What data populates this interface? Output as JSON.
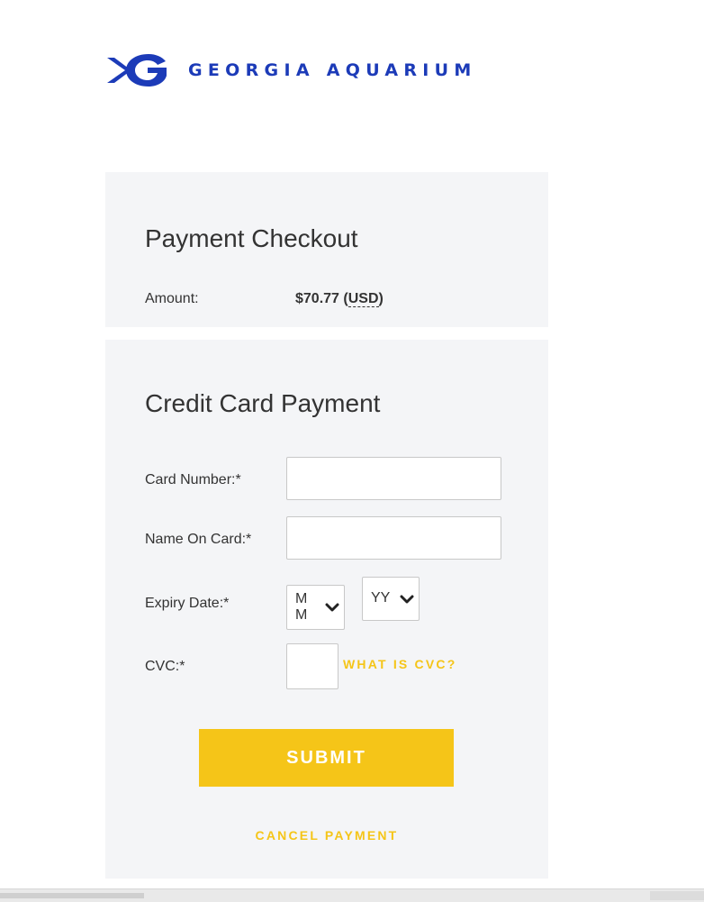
{
  "brand": {
    "logo_text": "GEORGIA AQUARIUM",
    "color": "#1c3bb8"
  },
  "checkout": {
    "title": "Payment Checkout",
    "amount_label": "Amount:",
    "amount_value": "$70.77",
    "currency": "USD"
  },
  "card_form": {
    "title": "Credit Card Payment",
    "card_number_label": "Card Number:*",
    "card_number_value": "",
    "name_label": "Name On Card:*",
    "name_value": "",
    "expiry_label": "Expiry Date:*",
    "month_select": "MM",
    "year_select": "YY",
    "cvc_label": "CVC:*",
    "cvc_value": "",
    "cvc_help_link": "WHAT IS CVC?",
    "submit_label": "SUBMIT",
    "cancel_label": "CANCEL PAYMENT"
  },
  "colors": {
    "accent": "#f5c518",
    "panel_bg": "#f4f5f7",
    "text": "#333333"
  }
}
